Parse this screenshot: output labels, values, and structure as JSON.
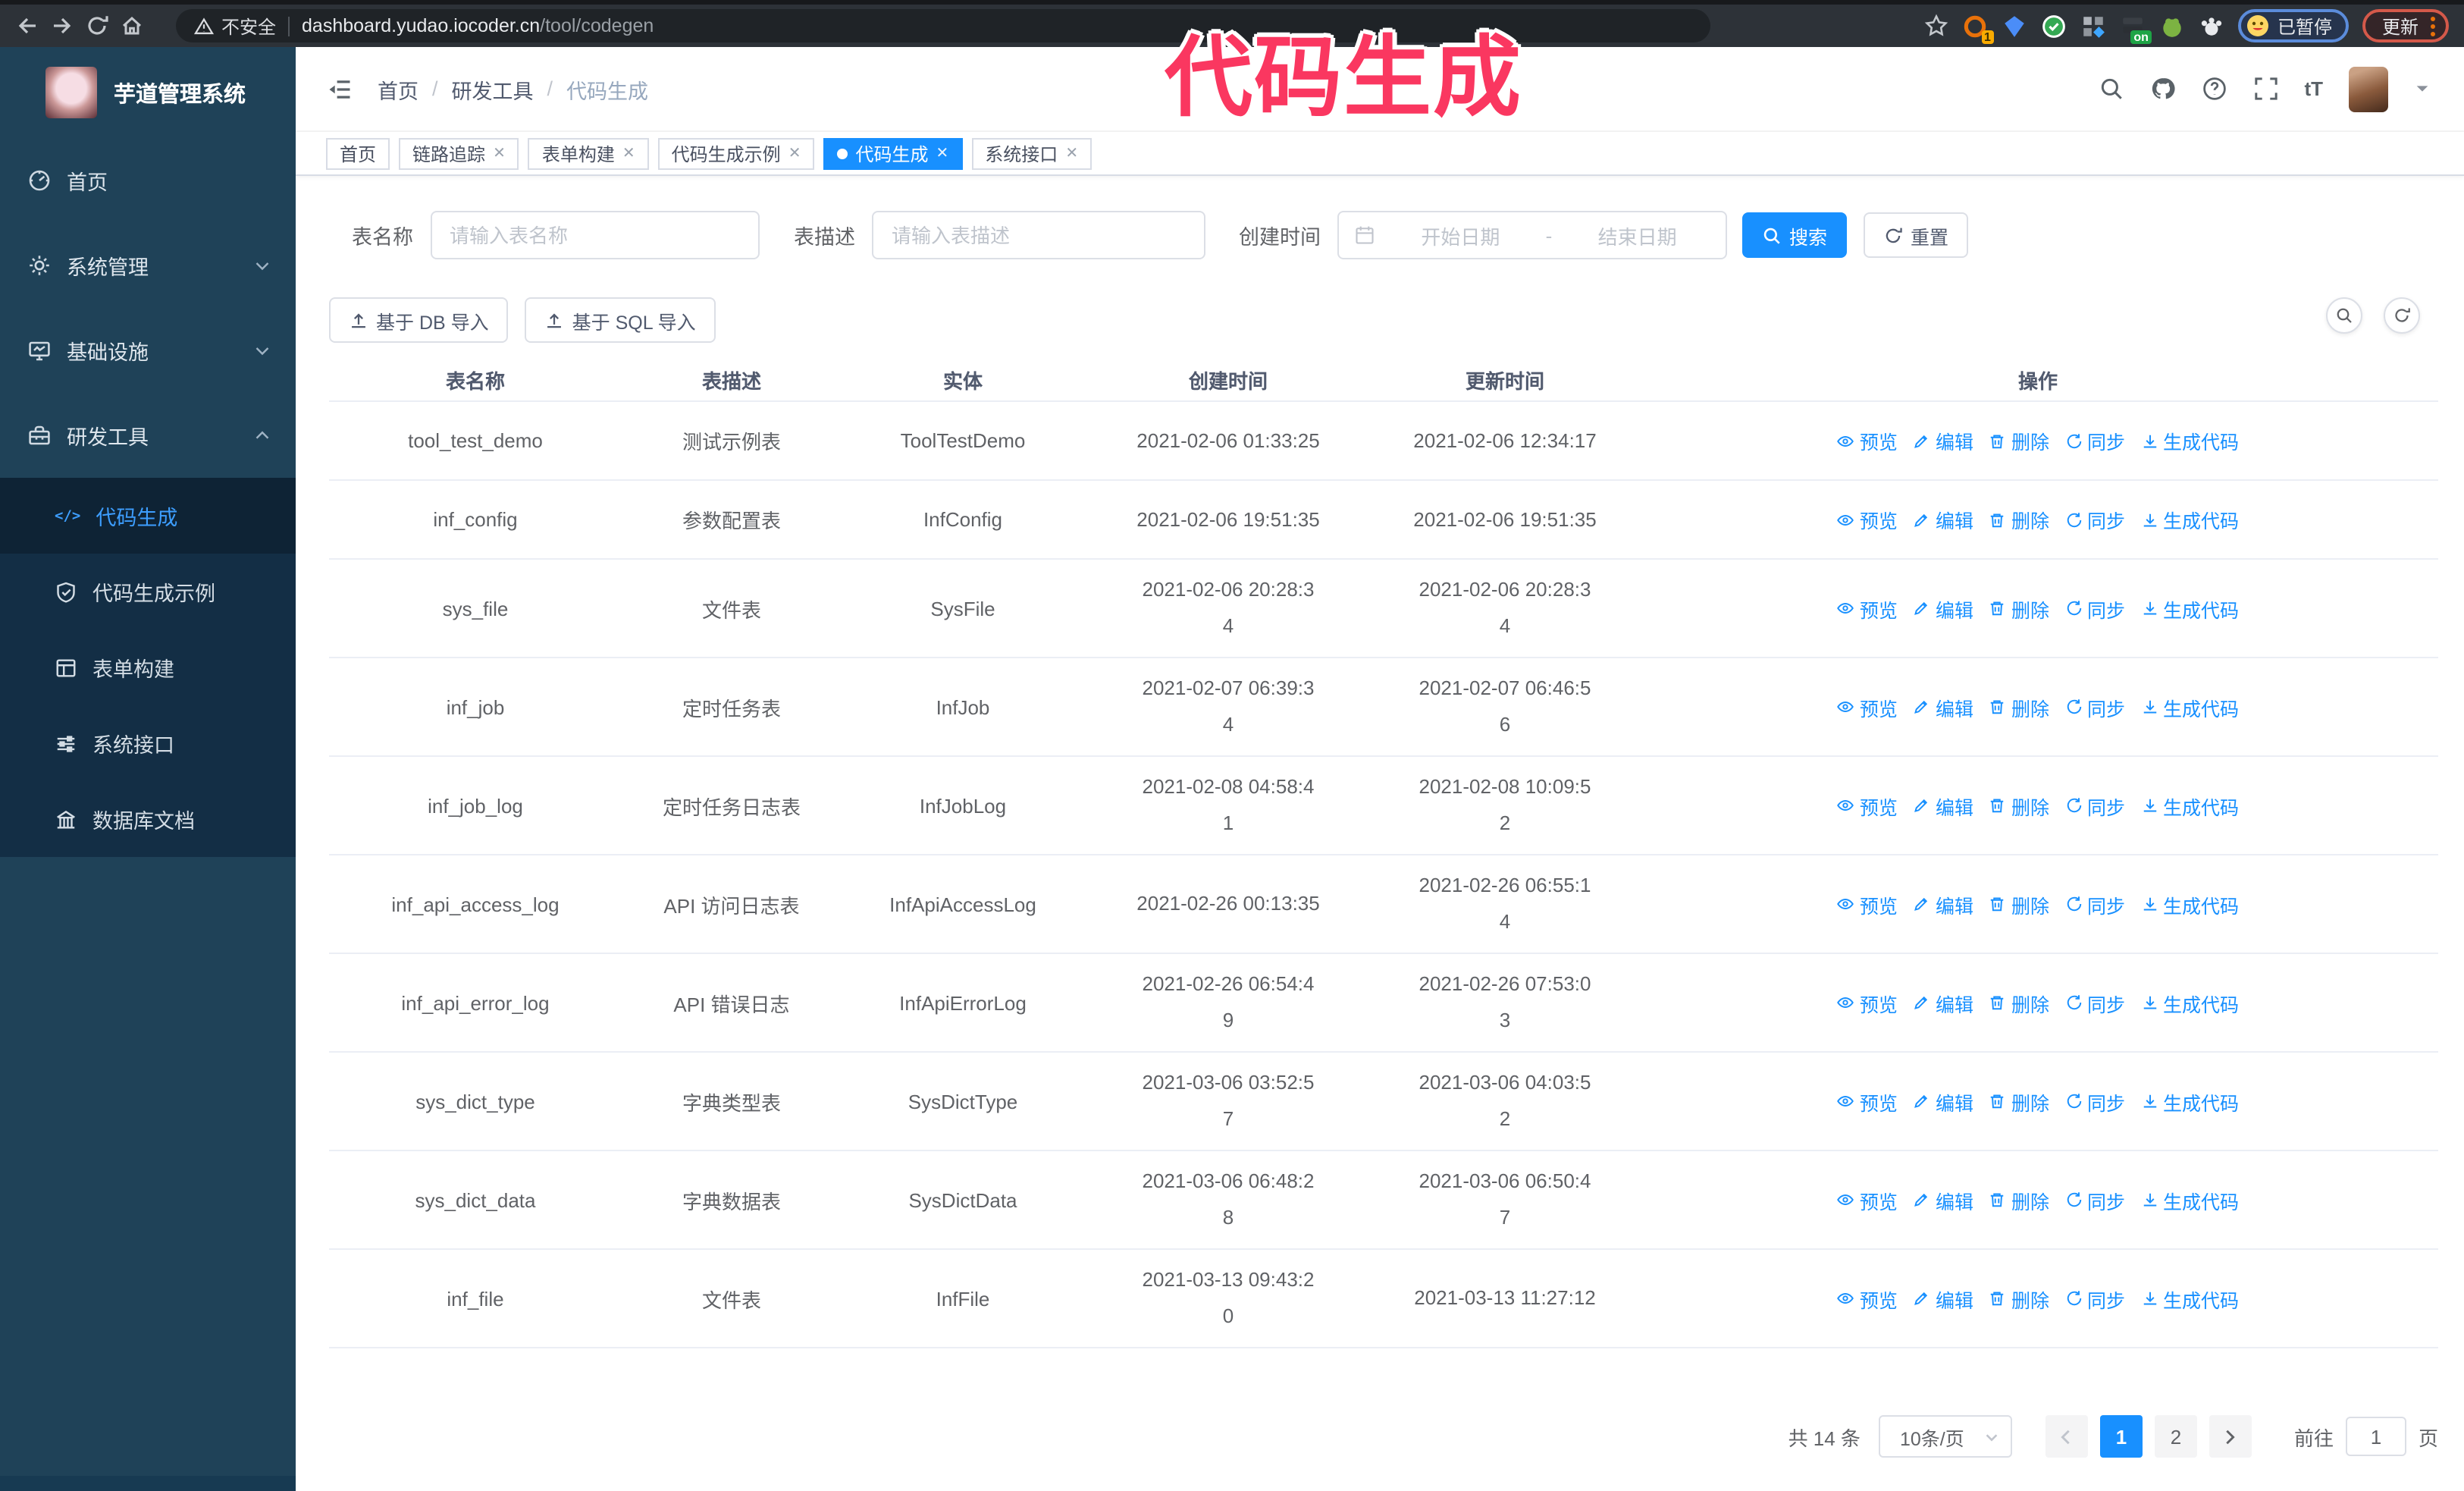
{
  "browser": {
    "security_label": "不安全",
    "url_host": "dashboard.yudao.iocoder.cn",
    "url_path": "/tool/codegen",
    "extension_badge": "1",
    "extension_on_badge": "on",
    "paused_chip": "已暂停",
    "update_button": "更新"
  },
  "annotation": {
    "text": "代码生成",
    "color": "#fa3760"
  },
  "sidebar": {
    "title": "芋道管理系统",
    "items": [
      {
        "label": "首页",
        "icon": "dashboard-icon"
      },
      {
        "label": "系统管理",
        "icon": "gear-icon"
      },
      {
        "label": "基础设施",
        "icon": "monitor-icon"
      },
      {
        "label": "研发工具",
        "icon": "toolbox-icon"
      }
    ],
    "subitems": [
      {
        "label": "代码生成",
        "icon": "code-icon",
        "active": true
      },
      {
        "label": "代码生成示例",
        "icon": "shield-check-icon"
      },
      {
        "label": "表单构建",
        "icon": "form-icon"
      },
      {
        "label": "系统接口",
        "icon": "sliders-icon"
      },
      {
        "label": "数据库文档",
        "icon": "database-icon"
      }
    ]
  },
  "topbar": {
    "breadcrumb": [
      "首页",
      "研发工具",
      "代码生成"
    ]
  },
  "tabs": [
    {
      "label": "首页"
    },
    {
      "label": "链路追踪"
    },
    {
      "label": "表单构建"
    },
    {
      "label": "代码生成示例"
    },
    {
      "label": "代码生成"
    },
    {
      "label": "系统接口"
    }
  ],
  "filters": {
    "name_label": "表名称",
    "name_placeholder": "请输入表名称",
    "desc_label": "表描述",
    "desc_placeholder": "请输入表描述",
    "time_label": "创建时间",
    "start_placeholder": "开始日期",
    "range_separator": "-",
    "end_placeholder": "结束日期",
    "search_label": "搜索",
    "reset_label": "重置"
  },
  "toolbar": {
    "import_db_label": "基于 DB 导入",
    "import_sql_label": "基于 SQL 导入"
  },
  "table": {
    "headers": [
      "表名称",
      "表描述",
      "实体",
      "创建时间",
      "更新时间",
      "操作"
    ],
    "actions": [
      {
        "label": "预览",
        "icon": "eye-icon"
      },
      {
        "label": "编辑",
        "icon": "edit-icon"
      },
      {
        "label": "删除",
        "icon": "delete-icon"
      },
      {
        "label": "同步",
        "icon": "sync-icon"
      },
      {
        "label": "生成代码",
        "icon": "download-icon"
      }
    ],
    "rows": [
      {
        "name": "tool_test_demo",
        "desc": "测试示例表",
        "entity": "ToolTestDemo",
        "created": "2021-02-06 01:33:25",
        "updated": "2021-02-06 12:34:17"
      },
      {
        "name": "inf_config",
        "desc": "参数配置表",
        "entity": "InfConfig",
        "created": "2021-02-06 19:51:35",
        "updated": "2021-02-06 19:51:35"
      },
      {
        "name": "sys_file",
        "desc": "文件表",
        "entity": "SysFile",
        "created": "2021-02-06 20:28:3\n4",
        "updated": "2021-02-06 20:28:3\n4"
      },
      {
        "name": "inf_job",
        "desc": "定时任务表",
        "entity": "InfJob",
        "created": "2021-02-07 06:39:3\n4",
        "updated": "2021-02-07 06:46:5\n6"
      },
      {
        "name": "inf_job_log",
        "desc": "定时任务日志表",
        "entity": "InfJobLog",
        "created": "2021-02-08 04:58:4\n1",
        "updated": "2021-02-08 10:09:5\n2"
      },
      {
        "name": "inf_api_access_log",
        "desc": "API 访问日志表",
        "entity": "InfApiAccessLog",
        "created": "2021-02-26 00:13:35",
        "updated": "2021-02-26 06:55:1\n4"
      },
      {
        "name": "inf_api_error_log",
        "desc": "API 错误日志",
        "entity": "InfApiErrorLog",
        "created": "2021-02-26 06:54:4\n9",
        "updated": "2021-02-26 07:53:0\n3"
      },
      {
        "name": "sys_dict_type",
        "desc": "字典类型表",
        "entity": "SysDictType",
        "created": "2021-03-06 03:52:5\n7",
        "updated": "2021-03-06 04:03:5\n2"
      },
      {
        "name": "sys_dict_data",
        "desc": "字典数据表",
        "entity": "SysDictData",
        "created": "2021-03-06 06:48:2\n8",
        "updated": "2021-03-06 06:50:4\n7"
      },
      {
        "name": "inf_file",
        "desc": "文件表",
        "entity": "InfFile",
        "created": "2021-03-13 09:43:2\n0",
        "updated": "2021-03-13 11:27:12"
      }
    ]
  },
  "pagination": {
    "total": "共 14 条",
    "page_size": "10条/页",
    "pages": [
      "1",
      "2"
    ],
    "goto_label": "前往",
    "goto_value": "1",
    "page_unit": "页"
  },
  "colors": {
    "primary": "#1890ff",
    "sidebar_bg": "#1f4258",
    "submenu_bg": "#132e45",
    "annotation": "#fa3760"
  }
}
